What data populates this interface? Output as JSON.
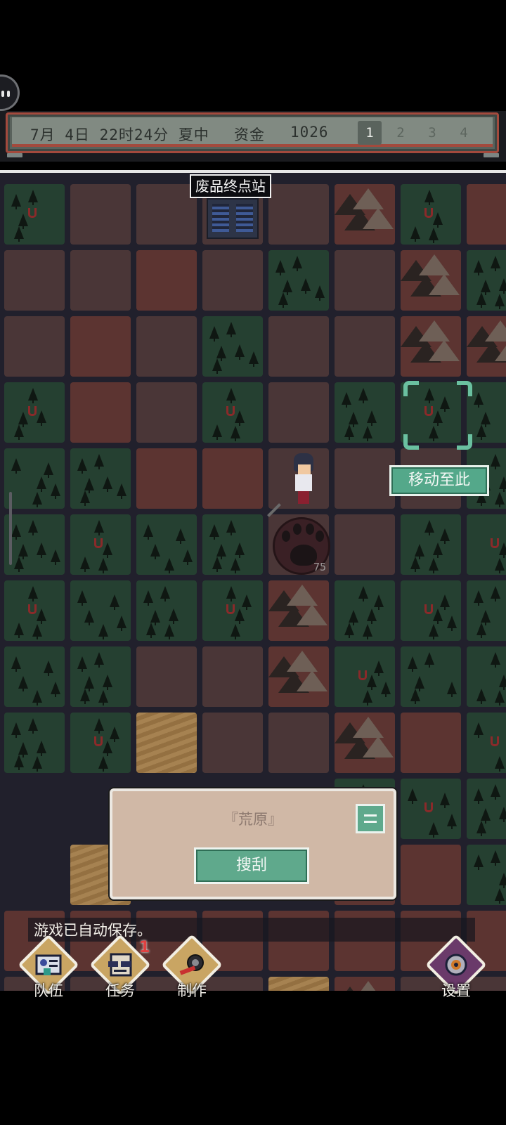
{
  "status_bar": {
    "date": "7月 4日 22时24分",
    "season": "夏中",
    "funds_label": "资金",
    "funds_value": "1026",
    "speeds": [
      "1",
      "2",
      "3",
      "4"
    ],
    "active_speed": "1"
  },
  "map": {
    "location_label": "废品终点站",
    "move_button": "移动至此",
    "enemy_level": "75"
  },
  "info_panel": {
    "terrain_name": "『荒原』",
    "scavenge_button": "搜刮"
  },
  "toast": {
    "message": "游戏已自动保存。"
  },
  "bottom_nav": {
    "team": "队伍",
    "quests": "任务",
    "quest_badge": "1",
    "craft": "制作",
    "settings": "设置"
  },
  "colors": {
    "accent_green": "#5fa98c",
    "status_frame": "#a34a3d",
    "panel_bg": "#d0b8a6"
  }
}
